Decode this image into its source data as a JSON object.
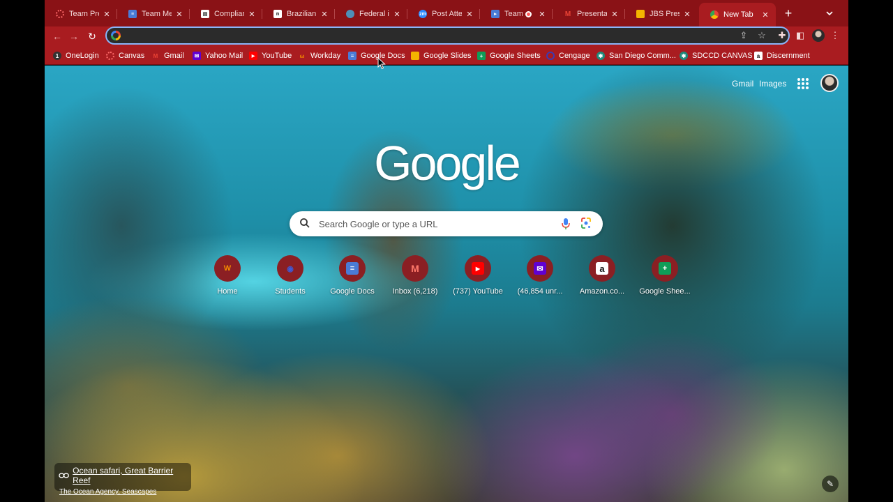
{
  "tabs": [
    {
      "title": "Team Prese",
      "icon": "red-dots-icon",
      "color": "#e53935"
    },
    {
      "title": "Team Meeti",
      "icon": "google-docs-icon",
      "color": "#4a7bd6"
    },
    {
      "title": "Compliance",
      "icon": "doc-page-icon",
      "color": "#ffffff"
    },
    {
      "title": "Brazilian m",
      "icon": "news-site-icon",
      "color": "#ffffff"
    },
    {
      "title": "Federal inv",
      "icon": "globe-icon",
      "color": "#4e8fb8"
    },
    {
      "title": "Post Attend",
      "icon": "zoom-icon",
      "color": "#2d8cff"
    },
    {
      "title": "Team M",
      "icon": "video-recording-icon",
      "color": "#4a7bd6"
    },
    {
      "title": "Presentatio",
      "icon": "gmail-icon",
      "color": "#ea4335"
    },
    {
      "title": "JBS Presen",
      "icon": "google-slides-icon",
      "color": "#f4b400"
    },
    {
      "title": "New Tab",
      "icon": "chrome-icon",
      "color": "#ffffff"
    }
  ],
  "omnibox": {
    "value": ""
  },
  "bookmarks": [
    {
      "label": "OneLogin",
      "icon": "onelogin-icon",
      "color": "#333333"
    },
    {
      "label": "Canvas",
      "icon": "canvas-icon",
      "color": "#e03c31"
    },
    {
      "label": "Gmail",
      "icon": "gmail-icon",
      "color": "#ea4335"
    },
    {
      "label": "Yahoo Mail",
      "icon": "yahoo-mail-icon",
      "color": "#6001d2"
    },
    {
      "label": "YouTube",
      "icon": "youtube-icon",
      "color": "#ff0000"
    },
    {
      "label": "Workday",
      "icon": "workday-icon",
      "color": "#f38b00"
    },
    {
      "label": "Google Docs",
      "icon": "google-docs-icon",
      "color": "#4a7bd6"
    },
    {
      "label": "Google Slides",
      "icon": "google-slides-icon",
      "color": "#f4b400"
    },
    {
      "label": "Google Sheets",
      "icon": "google-sheets-icon",
      "color": "#0f9d58"
    },
    {
      "label": "Cengage",
      "icon": "cengage-icon",
      "color": "#3b3bb3"
    },
    {
      "label": "San Diego Comm...",
      "icon": "sdccd-icon",
      "color": "#1f8a7a"
    },
    {
      "label": "SDCCD CANVAS",
      "icon": "sdccd-canvas-icon",
      "color": "#1f8a7a"
    },
    {
      "label": "Discernment",
      "icon": "amazon-icon",
      "color": "#ffffff"
    }
  ],
  "header": {
    "gmail": "Gmail",
    "images": "Images"
  },
  "logo": "Google",
  "search": {
    "placeholder": "Search Google or type a URL"
  },
  "shortcuts": [
    {
      "label": "Home",
      "icon": "workday-icon",
      "glyph": "W",
      "color": "#f38b00"
    },
    {
      "label": "Students",
      "icon": "globe-icon",
      "glyph": "◉",
      "color": "#3d5bd9"
    },
    {
      "label": "Google Docs",
      "icon": "google-docs-icon",
      "glyph": "≡",
      "color": "#4a7bd6"
    },
    {
      "label": "Inbox (6,218)",
      "icon": "gmail-icon",
      "glyph": "M",
      "color": "#ea4335"
    },
    {
      "label": "(737) YouTube",
      "icon": "youtube-icon",
      "glyph": "▶",
      "color": "#ff0000"
    },
    {
      "label": "(46,854 unr...",
      "icon": "yahoo-mail-icon",
      "glyph": "✉",
      "color": "#6001d2"
    },
    {
      "label": "Amazon.co...",
      "icon": "amazon-icon",
      "glyph": "a",
      "color": "#111111"
    },
    {
      "label": "Google Shee...",
      "icon": "google-sheets-icon",
      "glyph": "+",
      "color": "#0f9d58"
    }
  ],
  "attribution": {
    "title": "Ocean safari, Great Barrier Reef",
    "credit": "The Ocean Agency, Seascapes"
  }
}
